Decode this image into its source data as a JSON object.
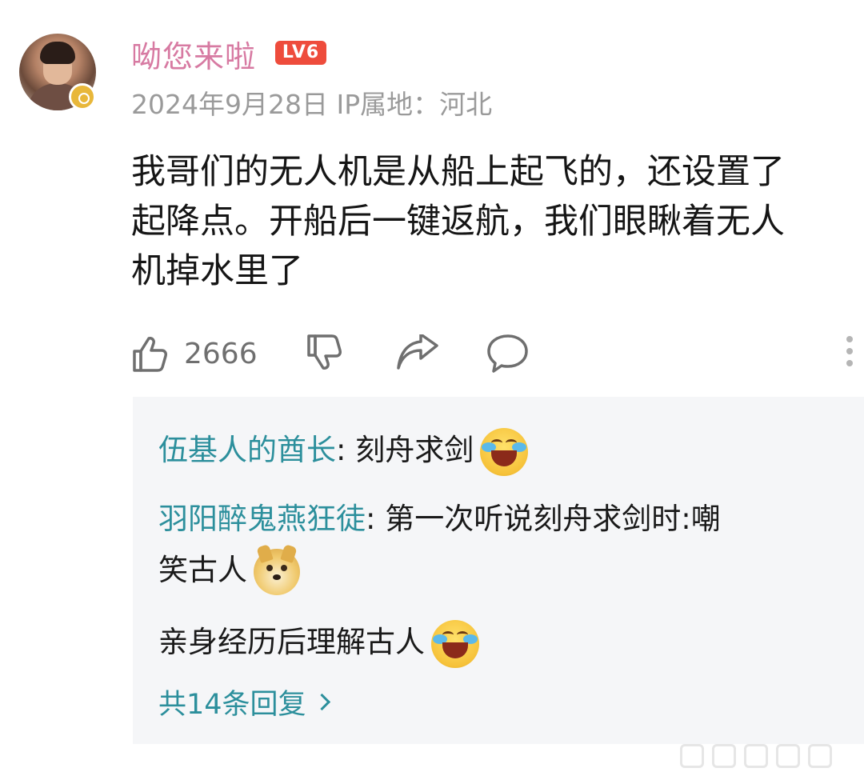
{
  "comment": {
    "username": "呦您来啦",
    "level_badge": "LV6",
    "meta": "2024年9月28日 IP属地：河北",
    "text": "我哥们的无人机是从船上起飞的，还设置了\n起降点。开船后一键返航，我们眼瞅着无人\n机掉水里了",
    "likes": "2666",
    "colors": {
      "username": "#d77aa2",
      "level_badge_bg": "#ee4c3c",
      "reply_author": "#2c8f9c"
    }
  },
  "icons": {
    "like": "thumbs-up-icon",
    "dislike": "thumbs-down-icon",
    "share": "share-arrow-icon",
    "reply": "comment-bubble-icon",
    "more": "more-vertical-icon"
  },
  "replies": [
    {
      "author": "伍基人的酋长",
      "separator": ": ",
      "text": "刻舟求剑",
      "emoji": "laughing-tears-emoji"
    },
    {
      "author": "羽阳醉鬼燕狂徒",
      "separator": ": ",
      "text": "第一次听说刻舟求剑时:嘲",
      "continuation": "笑古人",
      "emoji": "doge-emoji",
      "extra_line": "亲身经历后理解古人",
      "extra_emoji": "laughing-tears-emoji"
    }
  ],
  "reply_count": "共14条回复"
}
